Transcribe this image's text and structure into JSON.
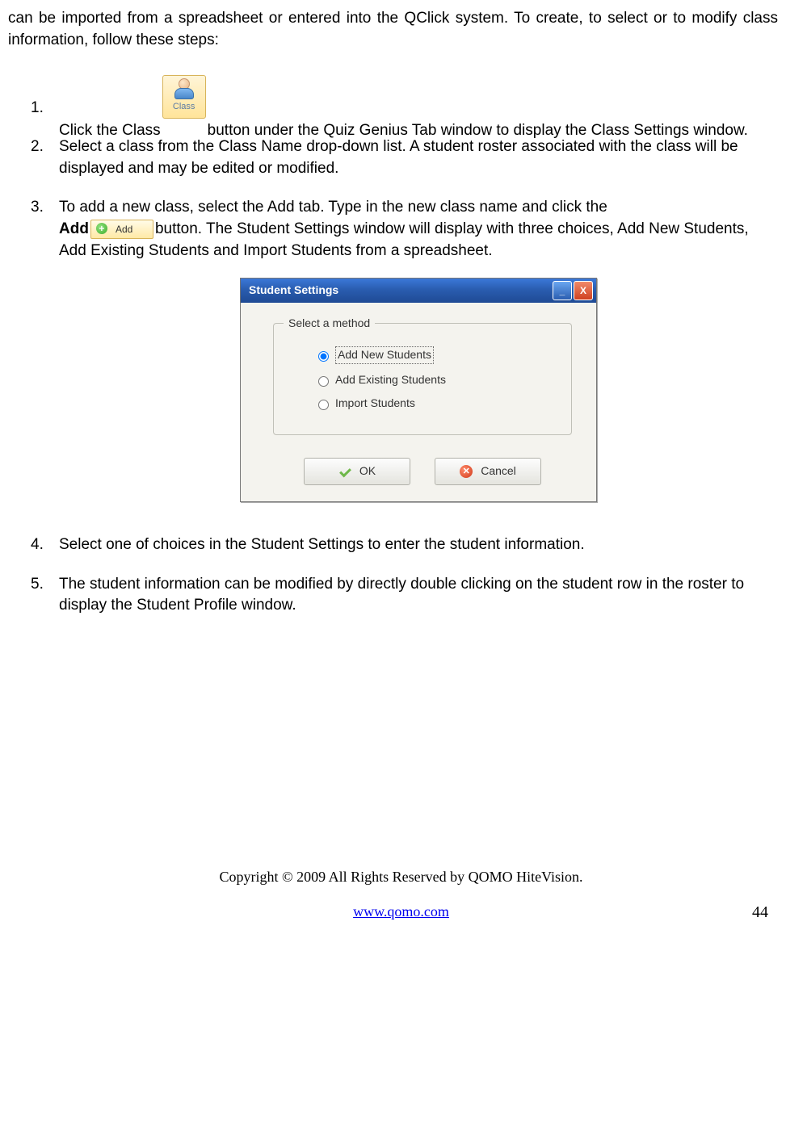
{
  "intro": "can be imported from a spreadsheet or entered into the QClick system. To create, to select or to modify class information, follow these steps:",
  "steps": {
    "s1": {
      "num": "1.",
      "pre": "Click the Class",
      "post": "button under the Quiz Genius Tab window to display the Class Settings window."
    },
    "s2": {
      "num": "2.",
      "text": "Select a class from the Class Name drop-down list. A student roster associated with the class will be displayed and may be edited or modified."
    },
    "s3": {
      "num": "3.",
      "line1": "To add a new class, select the Add tab. Type in the new class name and click the ",
      "boldAdd": "Add",
      "post": "button. The Student Settings window will display with three choices, Add New Students, Add Existing Students and Import Students from a spreadsheet."
    },
    "s4": {
      "num": "4.",
      "text": " Select one of choices in the Student Settings to enter the student information."
    },
    "s5": {
      "num": "5.",
      "text": "The student information can be modified by directly double clicking on the student row in the roster to display the Student Profile window."
    }
  },
  "classButton": {
    "label": "Class"
  },
  "addButton": {
    "label": "Add",
    "plus": "+"
  },
  "dialog": {
    "title": "Student Settings",
    "group": "Select a method",
    "opt1": "Add New Students",
    "opt2": "Add Existing Students",
    "opt3": "Import Students",
    "ok": "OK",
    "cancel": "Cancel",
    "minimize": "_",
    "close": "X"
  },
  "footer": {
    "copyright": "Copyright © 2009 All Rights Reserved by QOMO HiteVision.",
    "url": "www.qomo.com",
    "page": "44"
  }
}
